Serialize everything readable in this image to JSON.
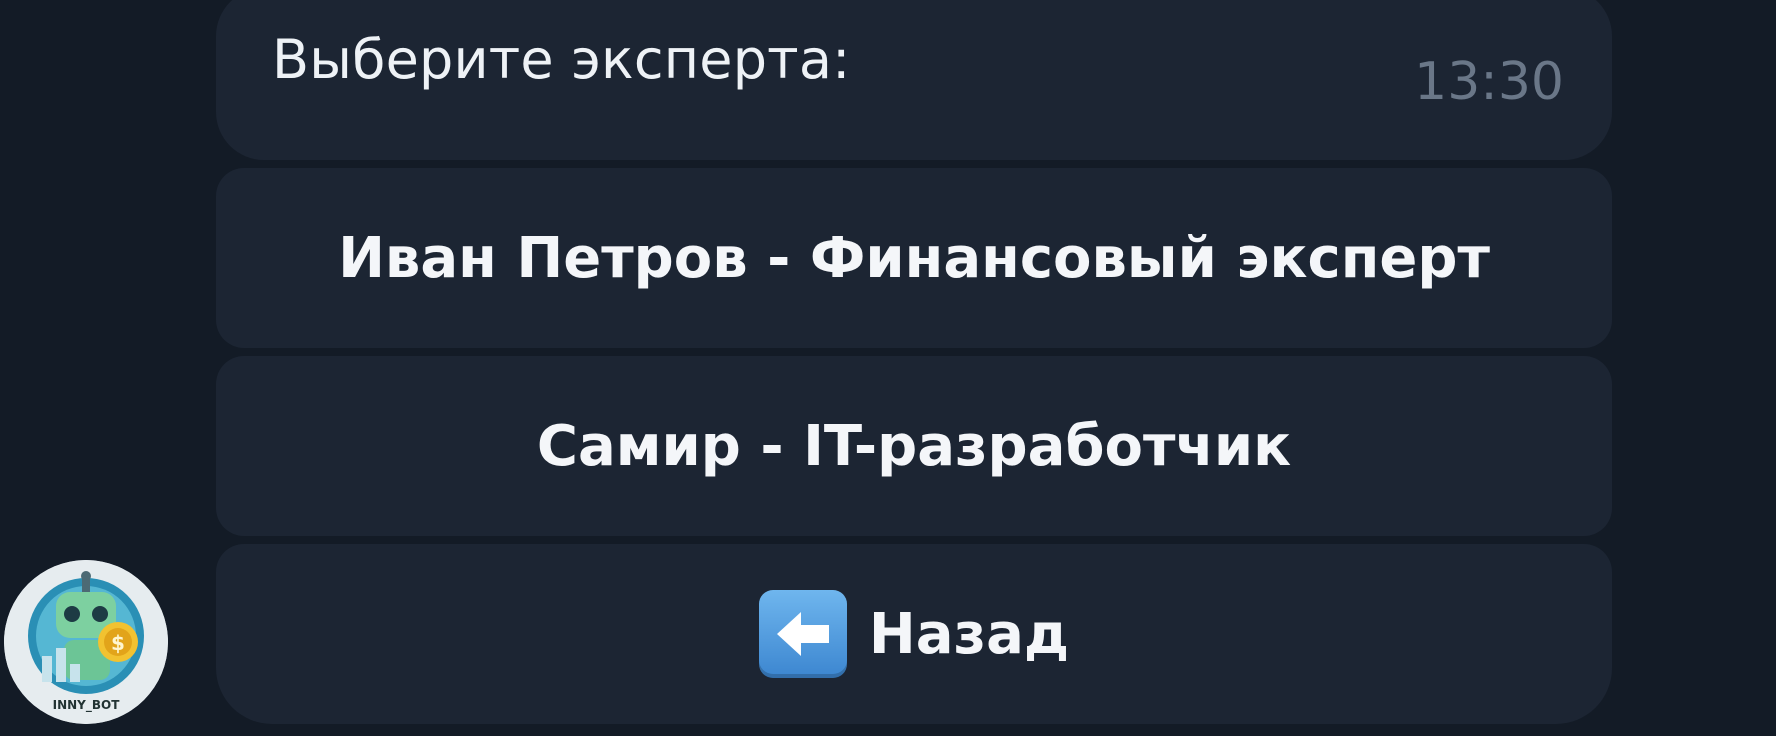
{
  "message": {
    "text": "Выберите эксперта:",
    "time": "13:30"
  },
  "keyboard": {
    "buttons": [
      {
        "label": "Иван Петров - Финансовый эксперт"
      },
      {
        "label": "Самир - IT-разработчик"
      },
      {
        "label": "Назад",
        "icon": "left-arrow-icon"
      }
    ]
  },
  "avatar": {
    "label": "INNY_BOT",
    "icon": "robot-avatar"
  }
}
